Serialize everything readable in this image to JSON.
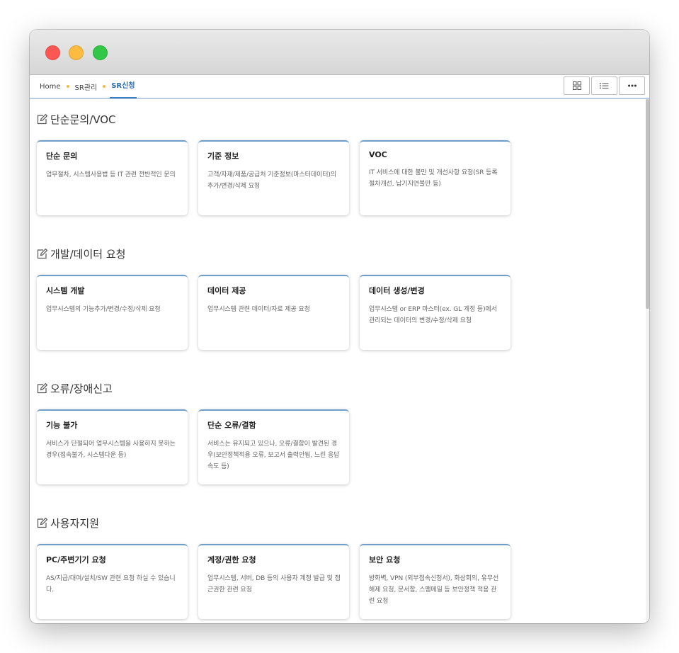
{
  "breadcrumb": {
    "home": "Home",
    "level1": "SR관리",
    "current": "SR신청"
  },
  "toolbar": {
    "grid_icon": "grid-icon",
    "list_icon": "list-icon",
    "more_icon": "more-icon"
  },
  "colors": {
    "accent": "#3a7fc1",
    "breadcrumb_dot": "#f2b84b",
    "card_top_border": "#6f9fc8"
  },
  "sections": [
    {
      "title": "단순문의/VOC",
      "cards": [
        {
          "title": "단순 문의",
          "desc": "업무절차, 시스템사용법 등 IT 관련 전반적인 문의"
        },
        {
          "title": "기준 정보",
          "desc": "고객/자재/제품/공급처 기준정보(마스터데이터)의 추가/변경/삭제 요청"
        },
        {
          "title": "VOC",
          "desc": "IT 서비스에 대한 불만 및 개선사항 요청(SR 등록절차개선, 납기지연불만 등)"
        }
      ]
    },
    {
      "title": "개발/데이터 요청",
      "cards": [
        {
          "title": "시스템 개발",
          "desc": "업무시스템의 기능추가/변경/수정/삭제 요청"
        },
        {
          "title": "데이터 제공",
          "desc": "업무시스템 관련 데이터/자료 제공 요청"
        },
        {
          "title": "데이터 생성/변경",
          "desc": "업무시스템 or ERP 마스터(ex. GL 계정 등)에서 관리되는 데이터의 변경/수정/삭제 요청"
        }
      ]
    },
    {
      "title": "오류/장애신고",
      "cards": [
        {
          "title": "기능 불가",
          "desc": "서비스가 단절되어 업무시스템을 사용하지 못하는 경우(접속불가, 시스템다운 등)"
        },
        {
          "title": "단순 오류/결함",
          "desc": "서비스는 유지되고 있으나, 오류/결함이 발견된 경우(보안정책적용 오류, 보고서 출력안됨, 느린 응답속도 등)"
        }
      ]
    },
    {
      "title": "사용자지원",
      "cards": [
        {
          "title": "PC/주변기기 요청",
          "desc": "AS/지급/대여/설치/SW 관련 요청 하실 수 있습니다."
        },
        {
          "title": "계정/권한 요청",
          "desc": "업무시스템, 서버, DB 등의 사용자 계정 발급 및 접근권한 관련 요청"
        },
        {
          "title": "보안 요청",
          "desc": "방화벽, VPN (외부접속신청서), 화상회의, 유무선 해제 요청, 문서함, 스팸메일 등 보안정책 적용 관련 요청"
        }
      ]
    }
  ]
}
